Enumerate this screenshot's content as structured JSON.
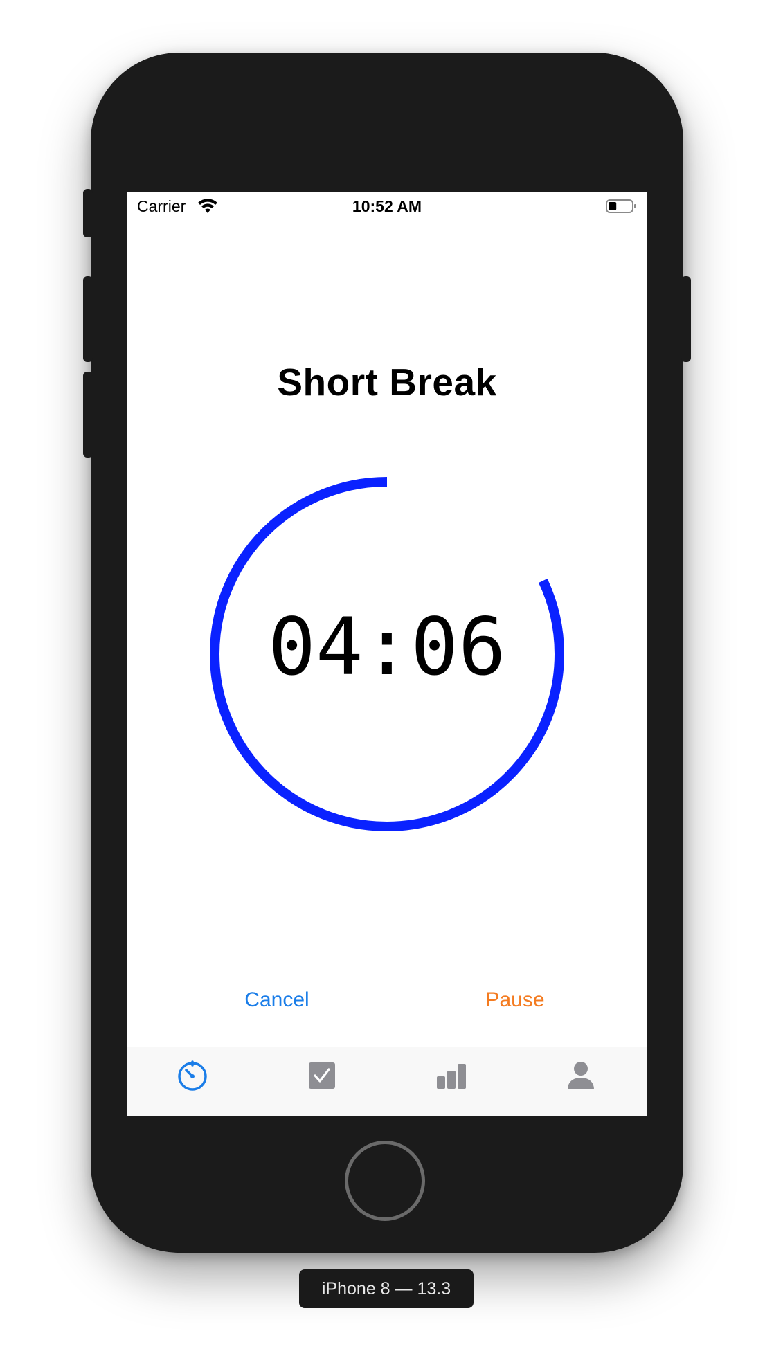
{
  "status_bar": {
    "carrier": "Carrier",
    "time": "10:52 AM",
    "wifi_icon": "wifi-icon",
    "battery_icon": "battery-icon",
    "battery_level": 0.35
  },
  "screen": {
    "title": "Short Break",
    "timer": "04:06",
    "progress_fraction": 0.82,
    "ring_color": "#0a22ff"
  },
  "actions": {
    "cancel_label": "Cancel",
    "cancel_color": "#1a7de8",
    "pause_label": "Pause",
    "pause_color": "#f47b20"
  },
  "tab_bar": {
    "active_color": "#1a7de8",
    "inactive_color": "#8e8e93",
    "tabs": [
      {
        "icon": "timer-icon",
        "active": true
      },
      {
        "icon": "checkbox-icon",
        "active": false
      },
      {
        "icon": "bar-chart-icon",
        "active": false
      },
      {
        "icon": "person-icon",
        "active": false
      }
    ]
  },
  "simulator": {
    "device_label": "iPhone 8 — 13.3"
  }
}
